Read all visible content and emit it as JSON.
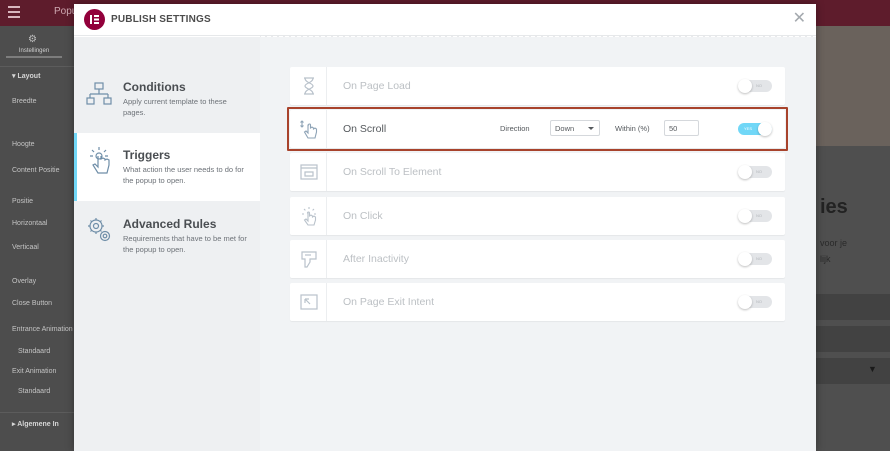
{
  "background": {
    "app_title": "Popu",
    "tab_label": "Instellingen",
    "section_layout": "Layout",
    "rows": [
      "Breedte",
      "Hoogte",
      "Content Positie",
      "Positie",
      "Horizontaal",
      "Verticaal",
      "Overlay",
      "Close Button",
      "Entrance Animation",
      "Standaard",
      "Exit Animation",
      "Standaard"
    ],
    "section_general": "Algemene In",
    "right_heading": "ies",
    "right_text_1": "voor je",
    "right_text_2": "lijk"
  },
  "modal": {
    "title": "PUBLISH SETTINGS",
    "close_glyph": "✕",
    "logo_icon": "elementor-logo-icon",
    "accent_color": "#71d7f7",
    "brand_color": "#92003b",
    "highlight_color": "#a8432c"
  },
  "nav": [
    {
      "title": "Conditions",
      "desc": "Apply current template to these pages.",
      "icon": "sitemap-icon",
      "active": false
    },
    {
      "title": "Triggers",
      "desc": "What action the user needs to do for the popup to open.",
      "icon": "tap-hand-icon",
      "active": true
    },
    {
      "title": "Advanced Rules",
      "desc": "Requirements that have to be met for the popup to open.",
      "icon": "gears-icon",
      "active": false
    }
  ],
  "triggers": [
    {
      "label": "On Page Load",
      "icon": "hourglass-icon",
      "toggle": "NO",
      "enabled": false
    },
    {
      "label": "On Scroll",
      "icon": "scroll-hand-icon",
      "toggle": "YES",
      "enabled": true,
      "direction_label": "Direction",
      "direction_value": "Down",
      "within_label": "Within (%)",
      "within_value": "50"
    },
    {
      "label": "On Scroll To Element",
      "icon": "window-element-icon",
      "toggle": "NO",
      "enabled": false
    },
    {
      "label": "On Click",
      "icon": "click-hand-icon",
      "toggle": "NO",
      "enabled": false
    },
    {
      "label": "After Inactivity",
      "icon": "inactivity-icon",
      "toggle": "NO",
      "enabled": false
    },
    {
      "label": "On Page Exit Intent",
      "icon": "exit-intent-icon",
      "toggle": "NO",
      "enabled": false
    }
  ]
}
